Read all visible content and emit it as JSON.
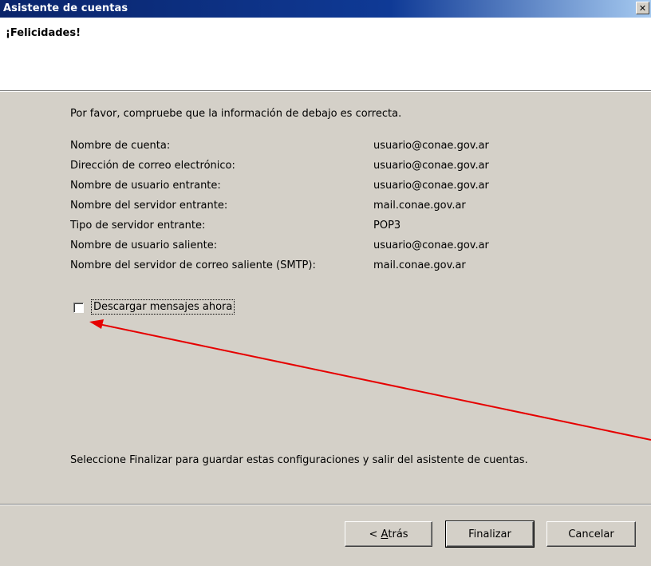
{
  "window": {
    "title": "Asistente de cuentas",
    "close_glyph": "✕"
  },
  "header": {
    "title": "¡Felicidades!"
  },
  "main": {
    "intro": "Por favor, compruebe que la información de debajo es correcta.",
    "fields": [
      {
        "label": "Nombre de cuenta:",
        "value": "usuario@conae.gov.ar"
      },
      {
        "label": "Dirección de correo electrónico:",
        "value": "usuario@conae.gov.ar"
      },
      {
        "label": "Nombre de usuario entrante:",
        "value": "usuario@conae.gov.ar"
      },
      {
        "label": "Nombre del servidor entrante:",
        "value": "mail.conae.gov.ar"
      },
      {
        "label": "Tipo de servidor entrante:",
        "value": "POP3"
      },
      {
        "label": "Nombre de usuario saliente:",
        "value": "usuario@conae.gov.ar"
      },
      {
        "label": "Nombre del servidor de correo saliente (SMTP):",
        "value": "mail.conae.gov.ar"
      }
    ],
    "download_checkbox": {
      "label": "Descargar mensajes ahora",
      "checked": false
    },
    "footer_text": "Seleccione Finalizar para guardar estas configuraciones y salir del asistente de cuentas."
  },
  "buttons": {
    "back_prefix": "< ",
    "back_accel": "A",
    "back_rest": "trás",
    "finish": "Finalizar",
    "cancel": "Cancelar"
  },
  "colors": {
    "dialog_bg": "#d4d0c8",
    "titlebar": "#0a246a",
    "annotation_arrow": "#e60000"
  }
}
